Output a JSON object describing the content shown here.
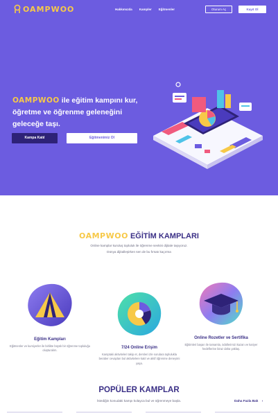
{
  "header": {
    "logo_text": "OAMPWOO",
    "nav": [
      "Hakkımızda",
      "Kampler",
      "Eğitmenler"
    ],
    "login_label": "Oturum Aç",
    "signup_label": "Kayıt Ol"
  },
  "hero": {
    "brand": "OAMPWOO",
    "title_rest": " ile eğitim kampını kur, öğretme ve öğrenme geleneğini geleceğe taşı.",
    "cta_primary": "Kampa Katıl",
    "cta_secondary": "Eğitmenimiz Ol"
  },
  "section": {
    "brand": "OAMPWOO",
    "title": "EĞİTİM KAMPLARI",
    "subtitle_line1": "Online kamplar kuruluş topluluk ile öğrenme sevkini dijitale taşıyoruz.",
    "subtitle_line2": "Dünya dijitalleşirken sen de bu fırsatı kaçırma"
  },
  "features": [
    {
      "title": "Eğitim Kampları",
      "desc": "Eğitmenler ve kursiyerler ile birlikte büyük bir öğrenme topluluğu oluşturalım."
    },
    {
      "title": "7/24 Online Erişim",
      "desc": "Kamptaki aktiviteleri takip et, dersleri izle sorulara toplulukla beraber cevapları bul aktivitelere katıl ve aktif öğrenme deneyimi yaşa."
    },
    {
      "title": "Online Rozetler ve Sertifika",
      "desc": "Eğitimleri başarı ile tamamla, ödüllerimizi kazan ve kariyer hedeflerine biraz daha yaklaş."
    }
  ],
  "popular": {
    "title": "POPÜLER KAMPLAR",
    "subtitle": "İstediğin konudaki kampı kolayca bul ve öğrenmeye başla.",
    "more_label": "Daha Fazla Bak",
    "more_arrow": "›"
  },
  "colors": {
    "hero_bg": "#6c5ce0",
    "brand_yellow": "#f7c948",
    "dark_purple": "#2e2277",
    "heading_purple": "#3a2f86"
  },
  "icons": [
    "logo-mark-icon",
    "tent-icon",
    "chart-circle-icon",
    "graduation-cap-icon",
    "chevron-right-icon"
  ]
}
